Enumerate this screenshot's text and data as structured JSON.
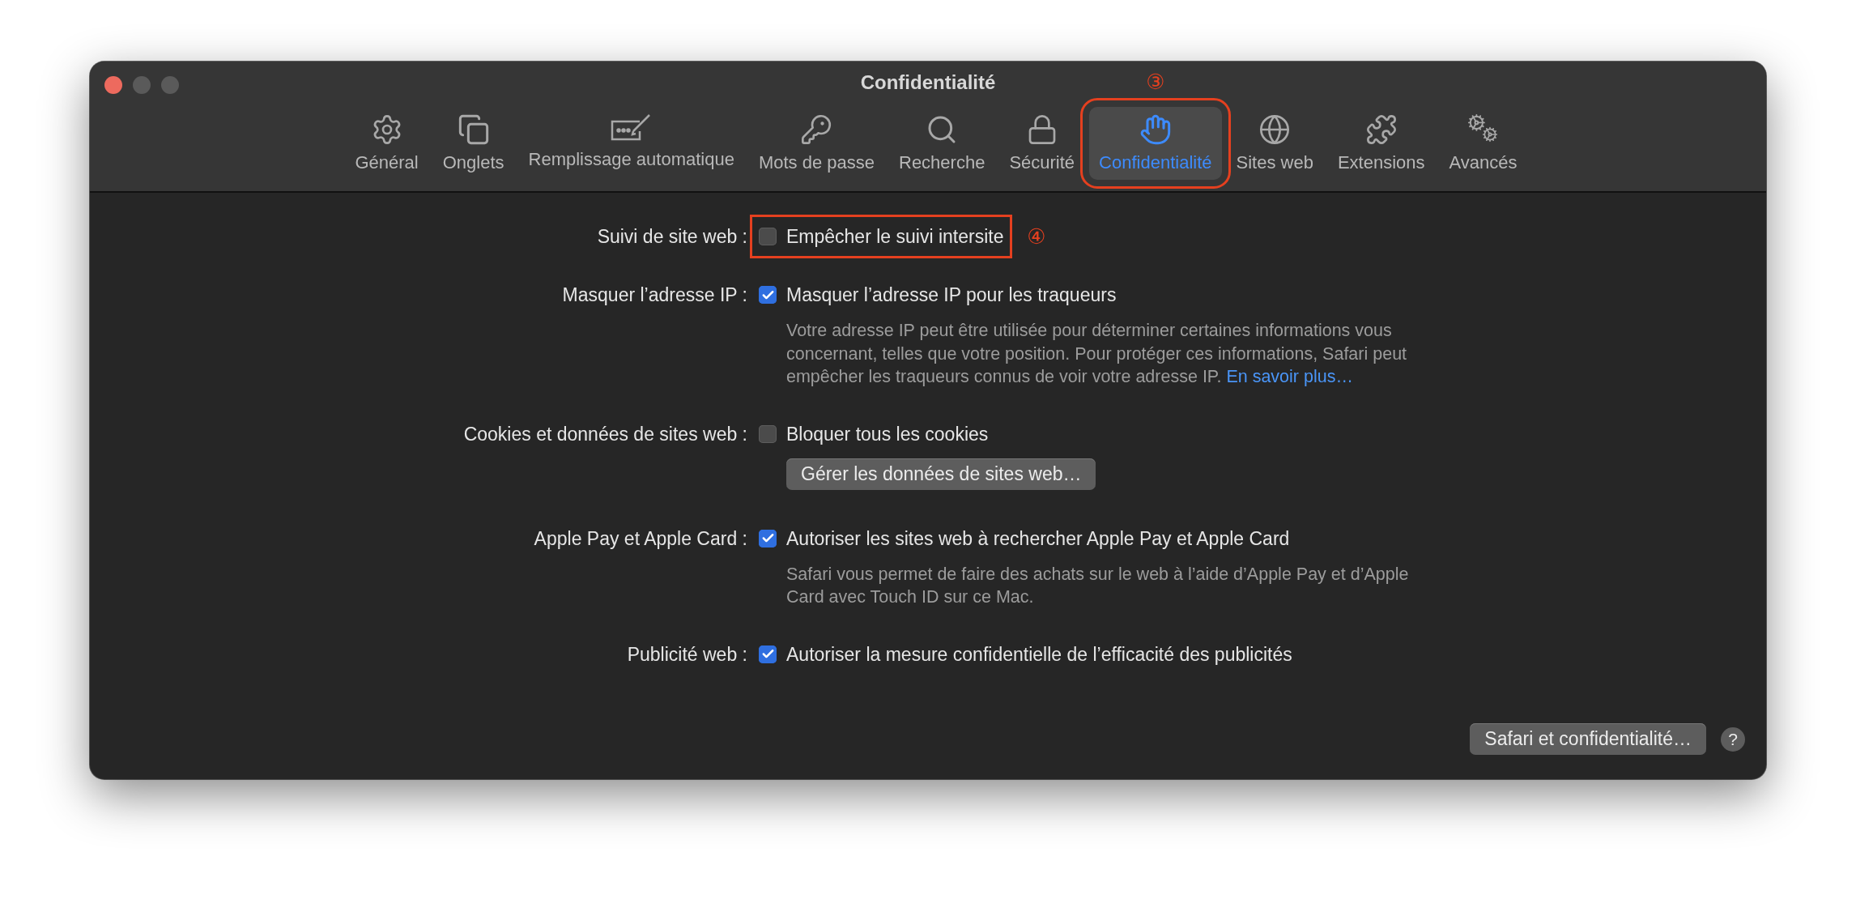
{
  "window": {
    "title": "Confidentialité"
  },
  "toolbar": [
    {
      "label": "Général",
      "selected": false
    },
    {
      "label": "Onglets",
      "selected": false
    },
    {
      "label": "Remplissage automatique",
      "selected": false
    },
    {
      "label": "Mots de passe",
      "selected": false
    },
    {
      "label": "Recherche",
      "selected": false
    },
    {
      "label": "Sécurité",
      "selected": false
    },
    {
      "label": "Confidentialité",
      "selected": true,
      "annotation": "③"
    },
    {
      "label": "Sites web",
      "selected": false
    },
    {
      "label": "Extensions",
      "selected": false
    },
    {
      "label": "Avancés",
      "selected": false
    }
  ],
  "settings": [
    {
      "label": "Suivi de site web :",
      "checkbox": {
        "text": "Empêcher le suivi intersite",
        "checked": false
      },
      "annotation": "④"
    },
    {
      "label": "Masquer l’adresse IP :",
      "checkbox": {
        "text": "Masquer l’adresse IP pour les traqueurs",
        "checked": true
      },
      "description": "Votre adresse IP peut être utilisée pour déterminer certaines informations vous concernant, telles que votre position. Pour protéger ces informations, Safari peut empêcher les traqueurs connus de voir votre adresse IP.",
      "link": "En savoir plus…"
    },
    {
      "label": "Cookies et données de sites web :",
      "checkbox": {
        "text": "Bloquer tous les cookies",
        "checked": false
      },
      "button": "Gérer les données de sites web…"
    },
    {
      "label": "Apple Pay et Apple Card :",
      "checkbox": {
        "text": "Autoriser les sites web à rechercher Apple Pay et Apple Card",
        "checked": true
      },
      "description": "Safari vous permet de faire des achats sur le web à l’aide d’Apple Pay et d’Apple Card avec Touch ID sur ce Mac."
    },
    {
      "label": "Publicité web :",
      "checkbox": {
        "text": "Autoriser la mesure confidentielle de l’efficacité des publicités",
        "checked": true
      }
    }
  ],
  "footer": {
    "button": "Safari et confidentialité…",
    "help": "?"
  }
}
